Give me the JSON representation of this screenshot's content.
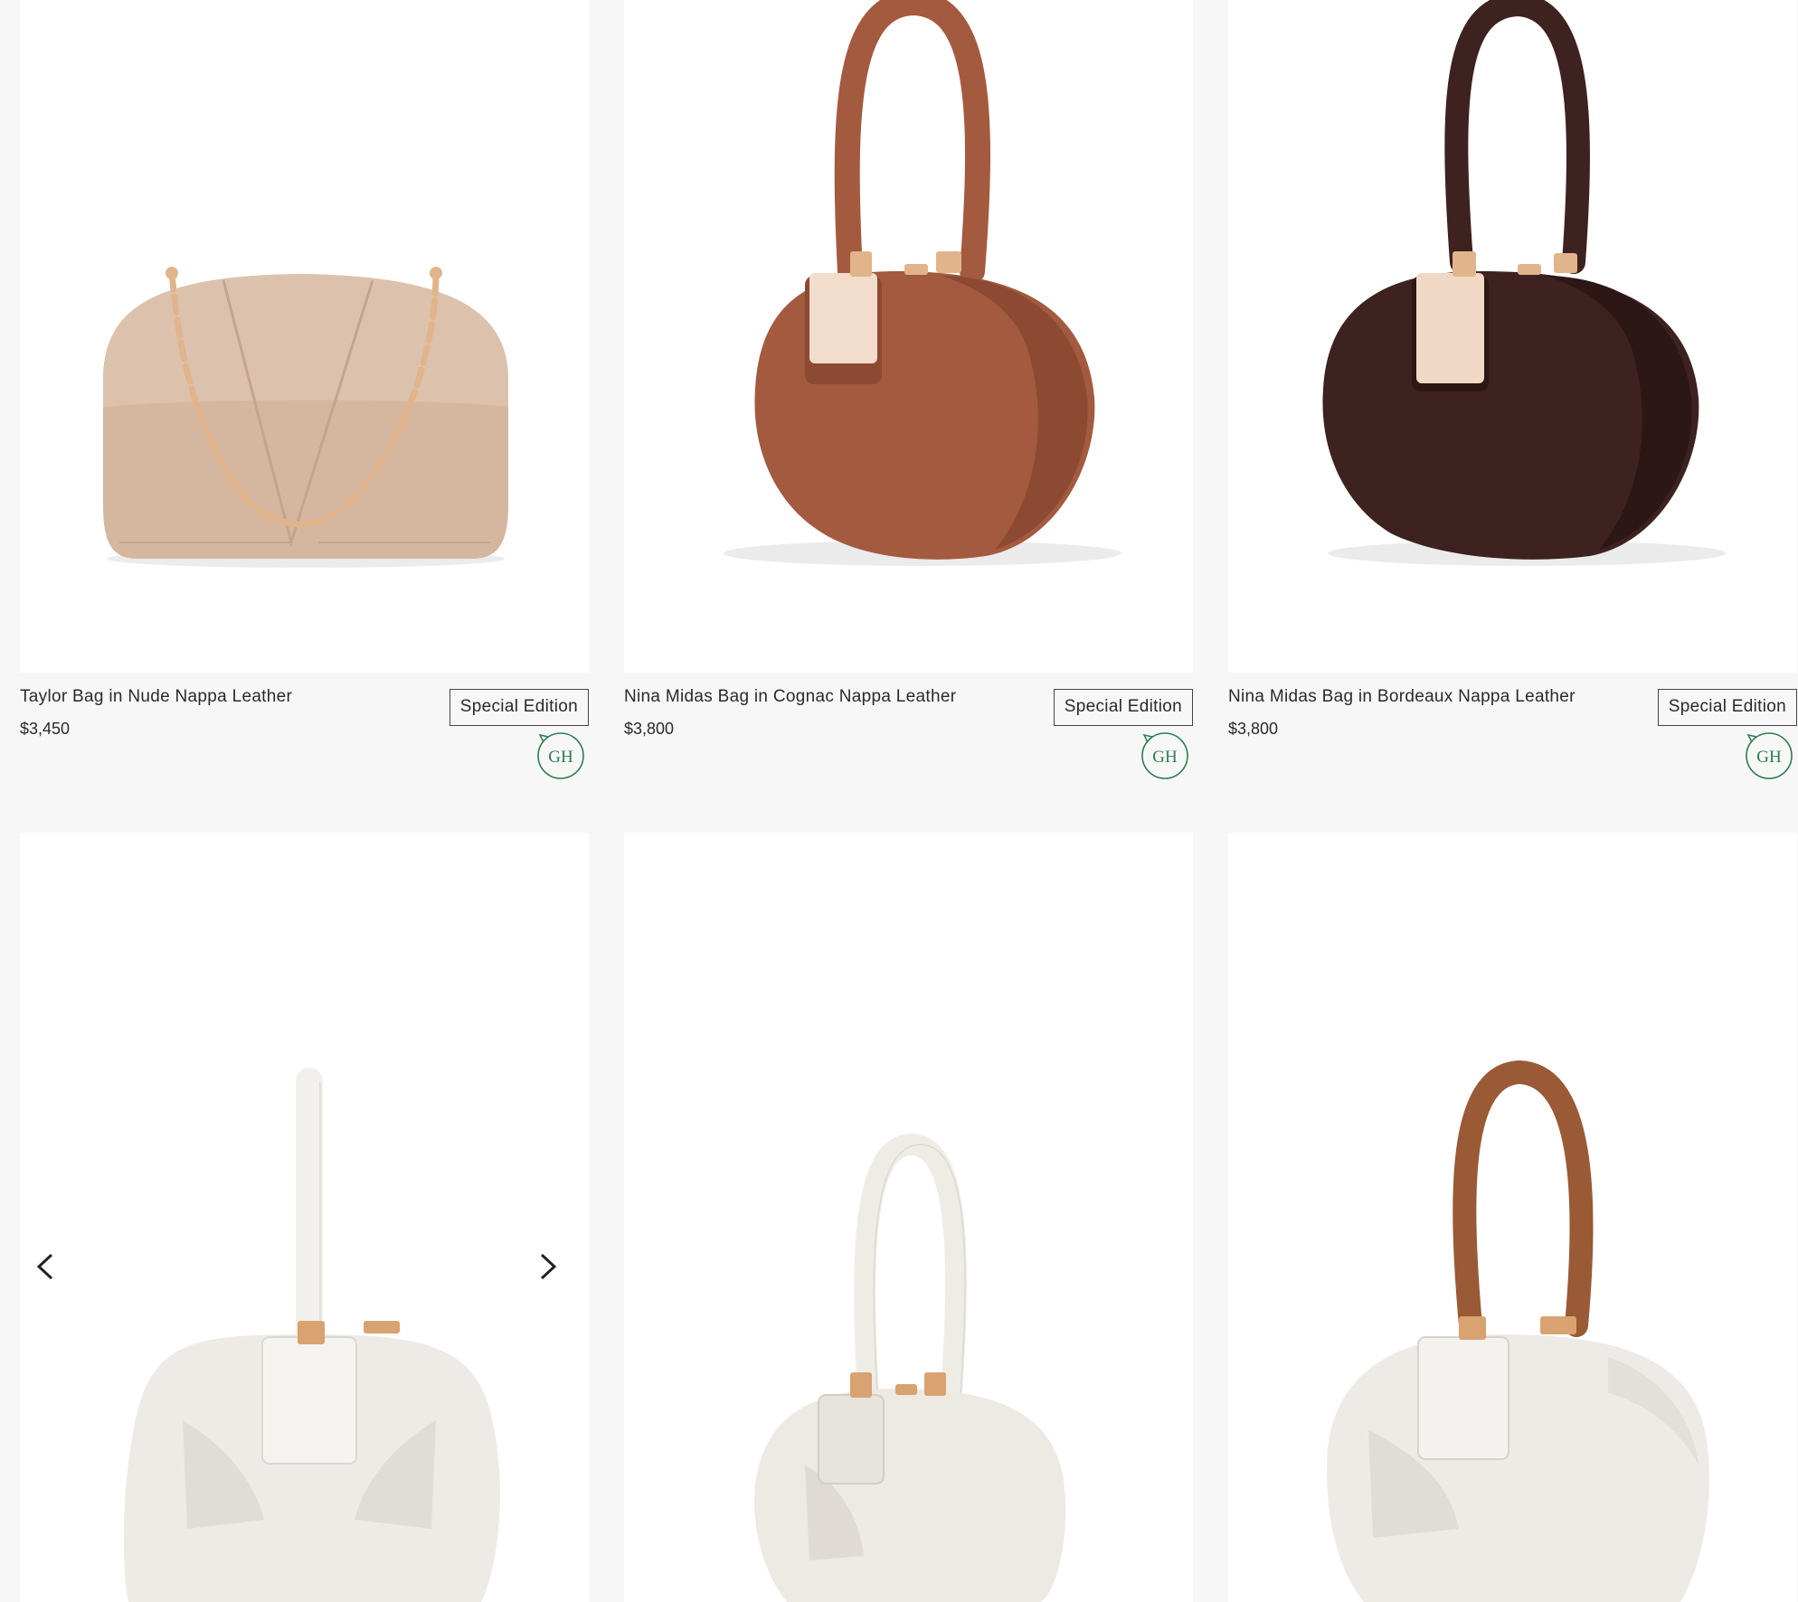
{
  "products": [
    {
      "name": "Taylor Bag in Nude Nappa Leather",
      "price": "$3,450",
      "badge": "Special Edition",
      "logo_text": "GH"
    },
    {
      "name": "Nina Midas Bag in Cognac Nappa Leather",
      "price": "$3,800",
      "badge": "Special Edition",
      "logo_text": "GH"
    },
    {
      "name": "Nina Midas Bag in Bordeaux Nappa Leather",
      "price": "$3,800",
      "badge": "Special Edition",
      "logo_text": "GH"
    },
    {
      "image": "white-nina-bag-photo"
    },
    {
      "image": "ivory-nina-bag-photo"
    },
    {
      "image": "white-bag-brown-handle-photo"
    }
  ],
  "carousel": {
    "prev_icon": "chevron-left-icon",
    "next_icon": "chevron-right-icon"
  },
  "colors": {
    "page_bg": "#f7f7f7",
    "card_bg": "#ffffff",
    "badge_border": "#444444",
    "logo_green": "#2e7d4f",
    "nude": "#d5b7a0",
    "cognac": "#a45a3e",
    "bordeaux": "#3d2220",
    "ivory": "#eeebe6",
    "gold": "#e2b48c"
  }
}
